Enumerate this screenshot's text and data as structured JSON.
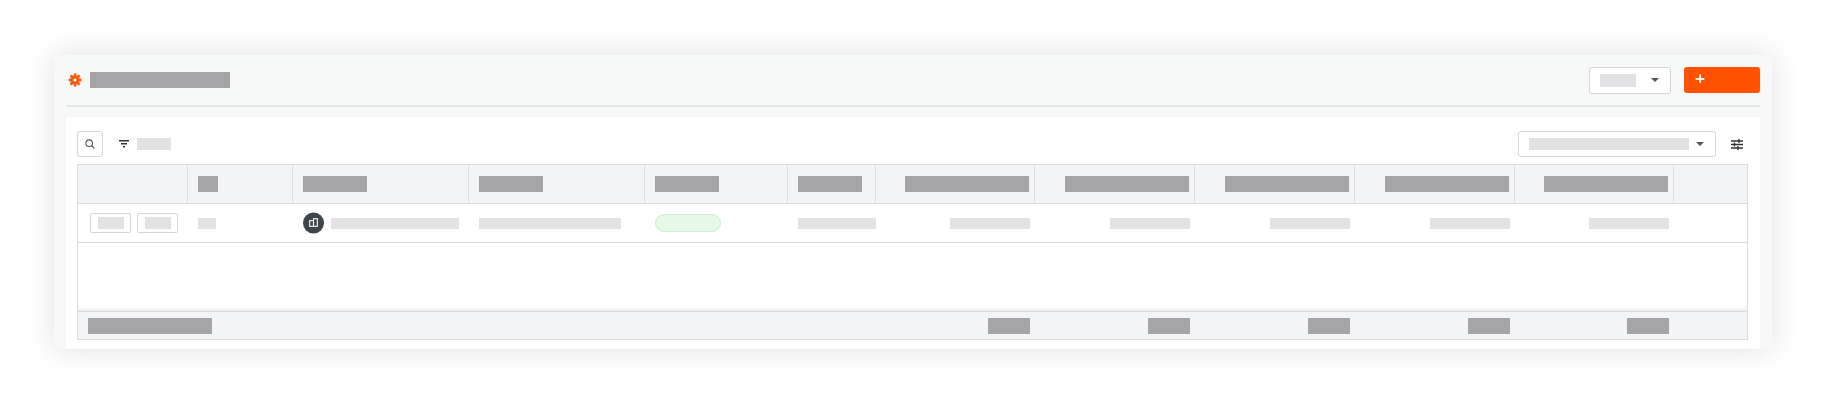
{
  "page_header": {
    "title_redacted": true,
    "view_select": {
      "value_redacted": true
    },
    "add_button": {
      "label": "+"
    }
  },
  "toolbar": {
    "filter_label_redacted": true,
    "view_dropdown": {
      "value_redacted": true
    }
  },
  "table": {
    "columns": [
      {
        "kind": "actions",
        "header_redacted": false
      },
      {
        "kind": "short",
        "header_redacted": true
      },
      {
        "kind": "avatar",
        "header_redacted": true
      },
      {
        "kind": "text",
        "header_redacted": true
      },
      {
        "kind": "status",
        "header_redacted": true
      },
      {
        "kind": "text",
        "header_redacted": true
      },
      {
        "kind": "number",
        "header_redacted": true
      },
      {
        "kind": "number",
        "header_redacted": true
      },
      {
        "kind": "number",
        "header_redacted": true
      },
      {
        "kind": "number",
        "header_redacted": true
      },
      {
        "kind": "number",
        "header_redacted": true
      },
      {
        "kind": "blank",
        "header_redacted": false
      }
    ],
    "rows": [
      {
        "redacted": true
      }
    ],
    "totals": {
      "label_redacted": true,
      "values_redacted": true
    }
  }
}
